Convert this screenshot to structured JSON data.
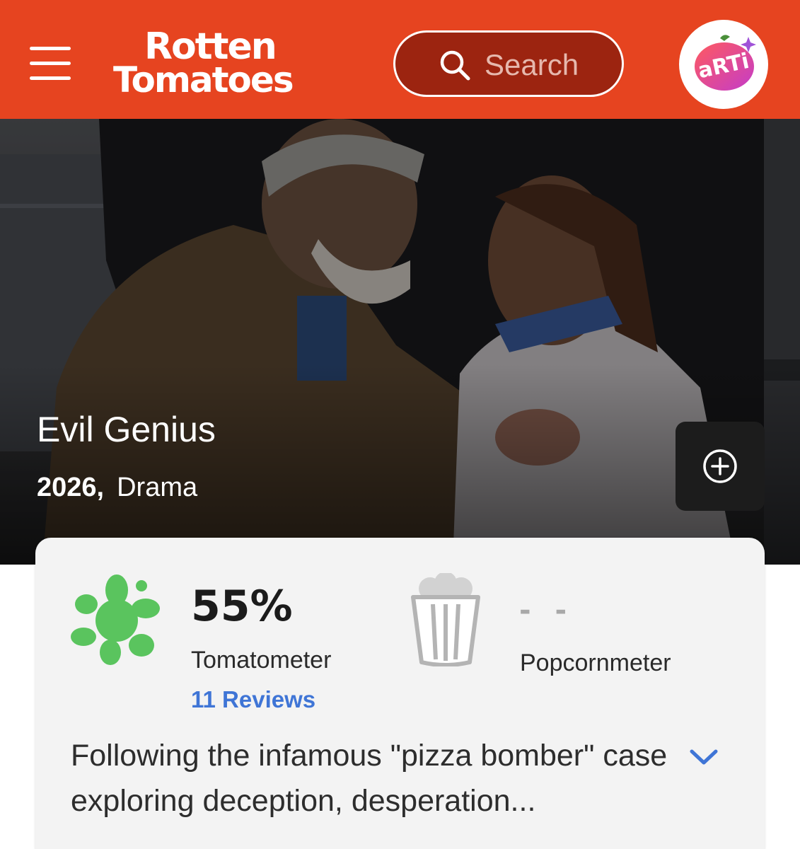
{
  "header": {
    "logo_line1": "Rotten",
    "logo_line2": "Tomatoes",
    "search_placeholder": "Search",
    "avatar_text": "aRTi"
  },
  "hero": {
    "title": "Evil Genius",
    "year": "2026,",
    "genre": "Drama"
  },
  "scores": {
    "tomatometer_value": "55%",
    "tomatometer_label": "Tomatometer",
    "reviews_link": "11 Reviews",
    "popcornmeter_value": "- -",
    "popcornmeter_label": "Popcornmeter"
  },
  "synopsis": "Following the infamous \"pizza bomber\" case exploring deception, desperation...",
  "colors": {
    "brand_red": "#e64420",
    "search_bg": "#9c2410",
    "splat_green": "#5ac45e",
    "link_blue": "#3f75d6",
    "card_bg": "#f3f3f3"
  },
  "icons": [
    "menu-icon",
    "search-icon",
    "plus-circle-icon",
    "rotten-splat-icon",
    "empty-popcorn-icon",
    "chevron-down-icon"
  ]
}
